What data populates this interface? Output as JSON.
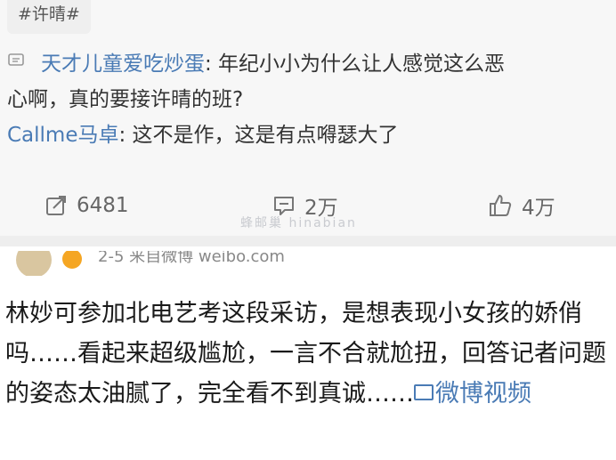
{
  "hashtag": "#许晴#",
  "comments": [
    {
      "user": "天才儿童爱吃炒蛋",
      "text_line1": ": 年纪小小为什么让人感觉这么恶",
      "text_line2": "心啊，真的要接许晴的班?"
    },
    {
      "user": "Callme马卓",
      "text_line1": ": 这不是作，这是有点嘚瑟大了"
    }
  ],
  "actions": {
    "repost_count": "6481",
    "comment_count": "2万",
    "like_count": "4万"
  },
  "watermark": "蜂邮巢 hinabian",
  "post2": {
    "meta": "2-5 来自微博 weibo.com",
    "text": "林妙可参加北电艺考这段采访，是想表现小女孩的娇俏吗……看起来超级尴尬，一言不合就尬扭，回答记者问题的姿态太油腻了，完全看不到真诚……",
    "video_link": "微博视频"
  }
}
